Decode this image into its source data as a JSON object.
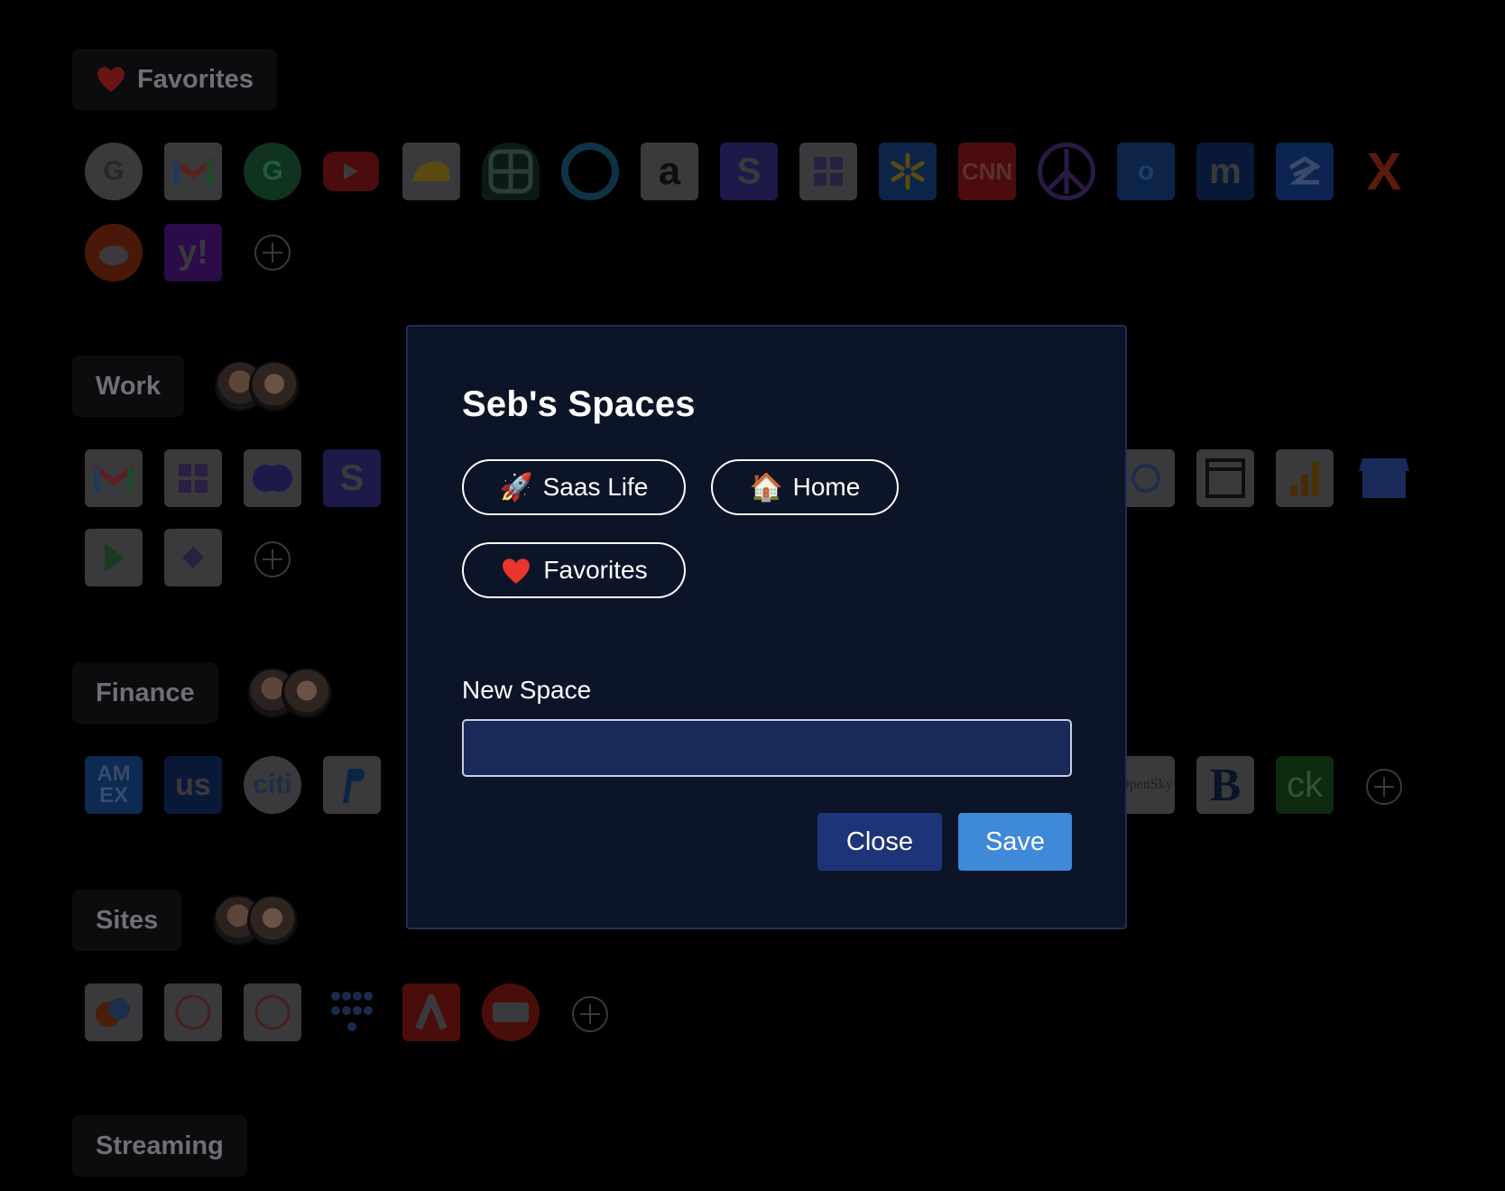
{
  "background": {
    "sections": [
      {
        "label": "Favorites",
        "icon": "heart-icon"
      },
      {
        "label": "Work"
      },
      {
        "label": "Finance"
      },
      {
        "label": "Sites"
      },
      {
        "label": "Streaming"
      }
    ],
    "icon_text": {
      "amex": "AM\nEX",
      "us": "us",
      "citi": "citi",
      "opensky": "OpenSky",
      "b": "B",
      "ck": "ck",
      "cnn": "CNN",
      "yahoo": "y!",
      "x": "X",
      "s": "S",
      "a": "a"
    }
  },
  "modal": {
    "title": "Seb's Spaces",
    "spaces": [
      {
        "emoji": "🚀",
        "label": "Saas Life"
      },
      {
        "emoji": "🏠",
        "label": "Home"
      },
      {
        "emoji": "❤️",
        "label": "Favorites"
      }
    ],
    "new_space_label": "New Space",
    "new_space_value": "",
    "close_label": "Close",
    "save_label": "Save"
  }
}
